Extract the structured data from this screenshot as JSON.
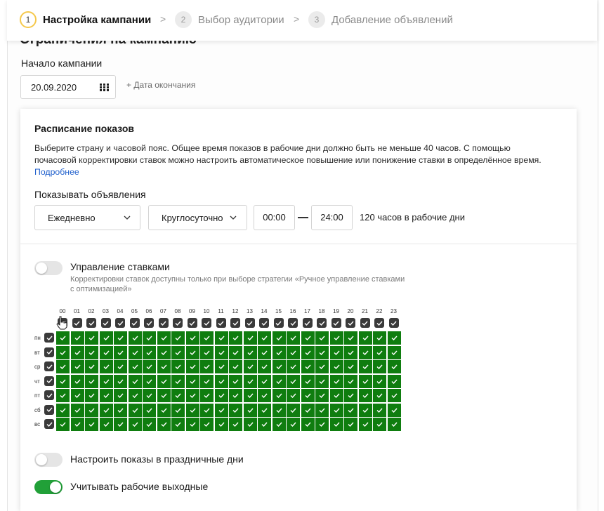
{
  "stepper": {
    "steps": [
      {
        "num": "1",
        "label": "Настройка кампании",
        "active": true
      },
      {
        "num": "2",
        "label": "Выбор аудитории",
        "active": false
      },
      {
        "num": "3",
        "label": "Добавление объявлений",
        "active": false
      }
    ],
    "separator": ">"
  },
  "limits": {
    "heading": "Ограничения на кампанию",
    "start_label": "Начало кампании",
    "start_date": "20.09.2020",
    "end_date_link": "+ Дата окончания"
  },
  "schedule": {
    "title": "Расписание показов",
    "description": "Выберите страну и часовой пояс. Общее время показов в рабочие дни должно быть не меньше 40 часов. С помощью почасовой корректировки ставок можно настроить автоматическое повышение или понижение ставки в определённое время.",
    "more_link": "Подробнее",
    "show_label": "Показывать объявления",
    "frequency": "Ежедневно",
    "period": "Круглосуточно",
    "time_from": "00:00",
    "time_to": "24:00",
    "hours_note": "120 часов в рабочие дни"
  },
  "bids": {
    "toggle_label": "Управление ставками",
    "toggle_on": false,
    "note": "Корректировки ставок доступны только при выборе стратегии «Ручное управление ставками с оптимизацией»"
  },
  "grid": {
    "hours": [
      "00",
      "01",
      "02",
      "03",
      "04",
      "05",
      "06",
      "07",
      "08",
      "09",
      "10",
      "11",
      "12",
      "13",
      "14",
      "15",
      "16",
      "17",
      "18",
      "19",
      "20",
      "21",
      "22",
      "23"
    ],
    "days": [
      "пн",
      "вт",
      "ср",
      "чт",
      "пт",
      "сб",
      "вс"
    ],
    "all_selected": true,
    "cell_color": "#0f7d0f"
  },
  "holidays": {
    "label": "Настроить показы в праздничные дни",
    "on": false
  },
  "working_weekends": {
    "label": "Учитывать рабочие выходные",
    "on": true
  },
  "colors": {
    "accent_green": "#21a038",
    "step_active_ring": "#f5c84b",
    "link": "#1f5fcc"
  }
}
